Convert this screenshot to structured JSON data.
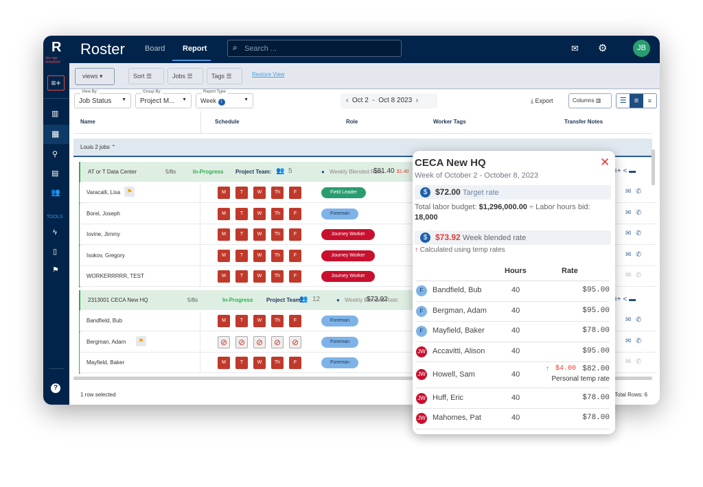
{
  "app": {
    "logo": "R",
    "env": "dev-app 4c5af93ef",
    "title": "Roster",
    "tabs": [
      "Board",
      "Report"
    ],
    "active_tab": "Report",
    "search_placeholder": "Search ...",
    "avatar": "JB"
  },
  "sidebar": {
    "tools_label": "TOOLS"
  },
  "toolbar": {
    "views": "views",
    "sort": "Sort",
    "jobs": "Jobs",
    "tags": "Tags",
    "restore": "Restore View"
  },
  "controls": {
    "view_by_label": "View By:",
    "view_by": "Job Status",
    "group_by_label": "Group By:",
    "group_by": "Project M...",
    "report_type_label": "Report Type:",
    "report_type": "Week",
    "date_range": "Oct 2  -  Oct 8 2023",
    "export": "Export",
    "columns": "Columns"
  },
  "table": {
    "headers": [
      "Name",
      "Schedule",
      "Role",
      "Worker Tags",
      "Transfer Notes"
    ],
    "group": "Louis 2 jobs",
    "jobs": [
      {
        "name": "AT or T Data Center",
        "ratio": "5/8s",
        "status": "In-Progress",
        "team_label": "Project Team:",
        "team_count": "5",
        "rate_label": "Weekly Blended Rate:",
        "rate": "$81.40",
        "rate_delta": "$1.40",
        "rows": [
          {
            "name": "Varacalli, Lisa",
            "flag": true,
            "days": [
              "M",
              "T",
              "W",
              "Th",
              "F"
            ],
            "off": false,
            "role": "Field Leader",
            "contact_active": true
          },
          {
            "name": "Borel, Joseph",
            "flag": false,
            "days": [
              "M",
              "T",
              "W",
              "Th",
              "F"
            ],
            "off": false,
            "role": "Foreman",
            "contact_active": true
          },
          {
            "name": "Iovine, Jimmy",
            "flag": false,
            "days": [
              "M",
              "T",
              "W",
              "Th",
              "F"
            ],
            "off": false,
            "role": "Journey Worker",
            "contact_active": true
          },
          {
            "name": "Isokov, Gregory",
            "flag": false,
            "days": [
              "M",
              "T",
              "W",
              "Th",
              "F"
            ],
            "off": false,
            "role": "Journey Worker",
            "contact_active": true
          },
          {
            "name": "WORKERRRRR, TEST",
            "flag": false,
            "days": [
              "M",
              "T",
              "W",
              "Th",
              "F"
            ],
            "off": false,
            "role": "Journey Worker",
            "contact_active": false
          }
        ]
      },
      {
        "name": "2313001 CECA New HQ",
        "ratio": "5/8s",
        "status": "In-Progress",
        "team_label": "Project Team:",
        "team_count": "12",
        "rate_label": "Weekly Blended Rate:",
        "rate": "$73.92",
        "rate_delta": "",
        "rows": [
          {
            "name": "Bandfield, Bub",
            "flag": false,
            "days": [
              "M",
              "T",
              "W",
              "Th",
              "F"
            ],
            "off": false,
            "role": "Foreman",
            "contact_active": true
          },
          {
            "name": "Bergman, Adam",
            "flag": true,
            "days": [
              "M",
              "T",
              "W",
              "Th",
              "F"
            ],
            "off": true,
            "role": "Foreman",
            "contact_active": true
          },
          {
            "name": "Mayfield, Baker",
            "flag": false,
            "days": [
              "M",
              "T",
              "W",
              "Th",
              "F"
            ],
            "off": false,
            "role": "Foreman",
            "contact_active": false
          }
        ]
      }
    ],
    "footer_selected": "1 row selected",
    "footer_total": "Total Rows: 6"
  },
  "role_colors": {
    "Field Leader": "#2a9d70",
    "Foreman": "#7eb3e8",
    "Journey Worker": "#c8102e"
  },
  "popup": {
    "title": "CECA New HQ",
    "subtitle": "Week of October 2 - October 8, 2023",
    "target_rate": "$72.00",
    "target_label": "Target rate",
    "budget_prefix": "Total labor budget: ",
    "budget": "$1,296,000.00",
    "budget_mid": " ÷ Labor hours bid: ",
    "hours_bid": "18,000",
    "blended_rate": "$73.92",
    "blended_label": "Week blended rate",
    "temp_note": "Calculated using temp rates",
    "col_hours": "Hours",
    "col_rate": "Rate",
    "workers": [
      {
        "initials": "F",
        "name": "Bandfield, Bub",
        "hours": "40",
        "rate": "$95.00",
        "delta": "",
        "note": ""
      },
      {
        "initials": "F",
        "name": "Bergman, Adam",
        "hours": "40",
        "rate": "$95.00",
        "delta": "",
        "note": ""
      },
      {
        "initials": "F",
        "name": "Mayfield, Baker",
        "hours": "40",
        "rate": "$78.00",
        "delta": "",
        "note": ""
      },
      {
        "initials": "JW",
        "name": "Accavitti, Alison",
        "hours": "40",
        "rate": "$95.00",
        "delta": "",
        "note": ""
      },
      {
        "initials": "JW",
        "name": "Howell, Sam",
        "hours": "40",
        "rate": "$82.00",
        "delta": "$4.00",
        "note": "Personal temp rate"
      },
      {
        "initials": "JW",
        "name": "Huff, Eric",
        "hours": "40",
        "rate": "$78.00",
        "delta": "",
        "note": ""
      },
      {
        "initials": "JW",
        "name": "Mahomes, Pat",
        "hours": "40",
        "rate": "$78.00",
        "delta": "",
        "note": ""
      }
    ]
  }
}
